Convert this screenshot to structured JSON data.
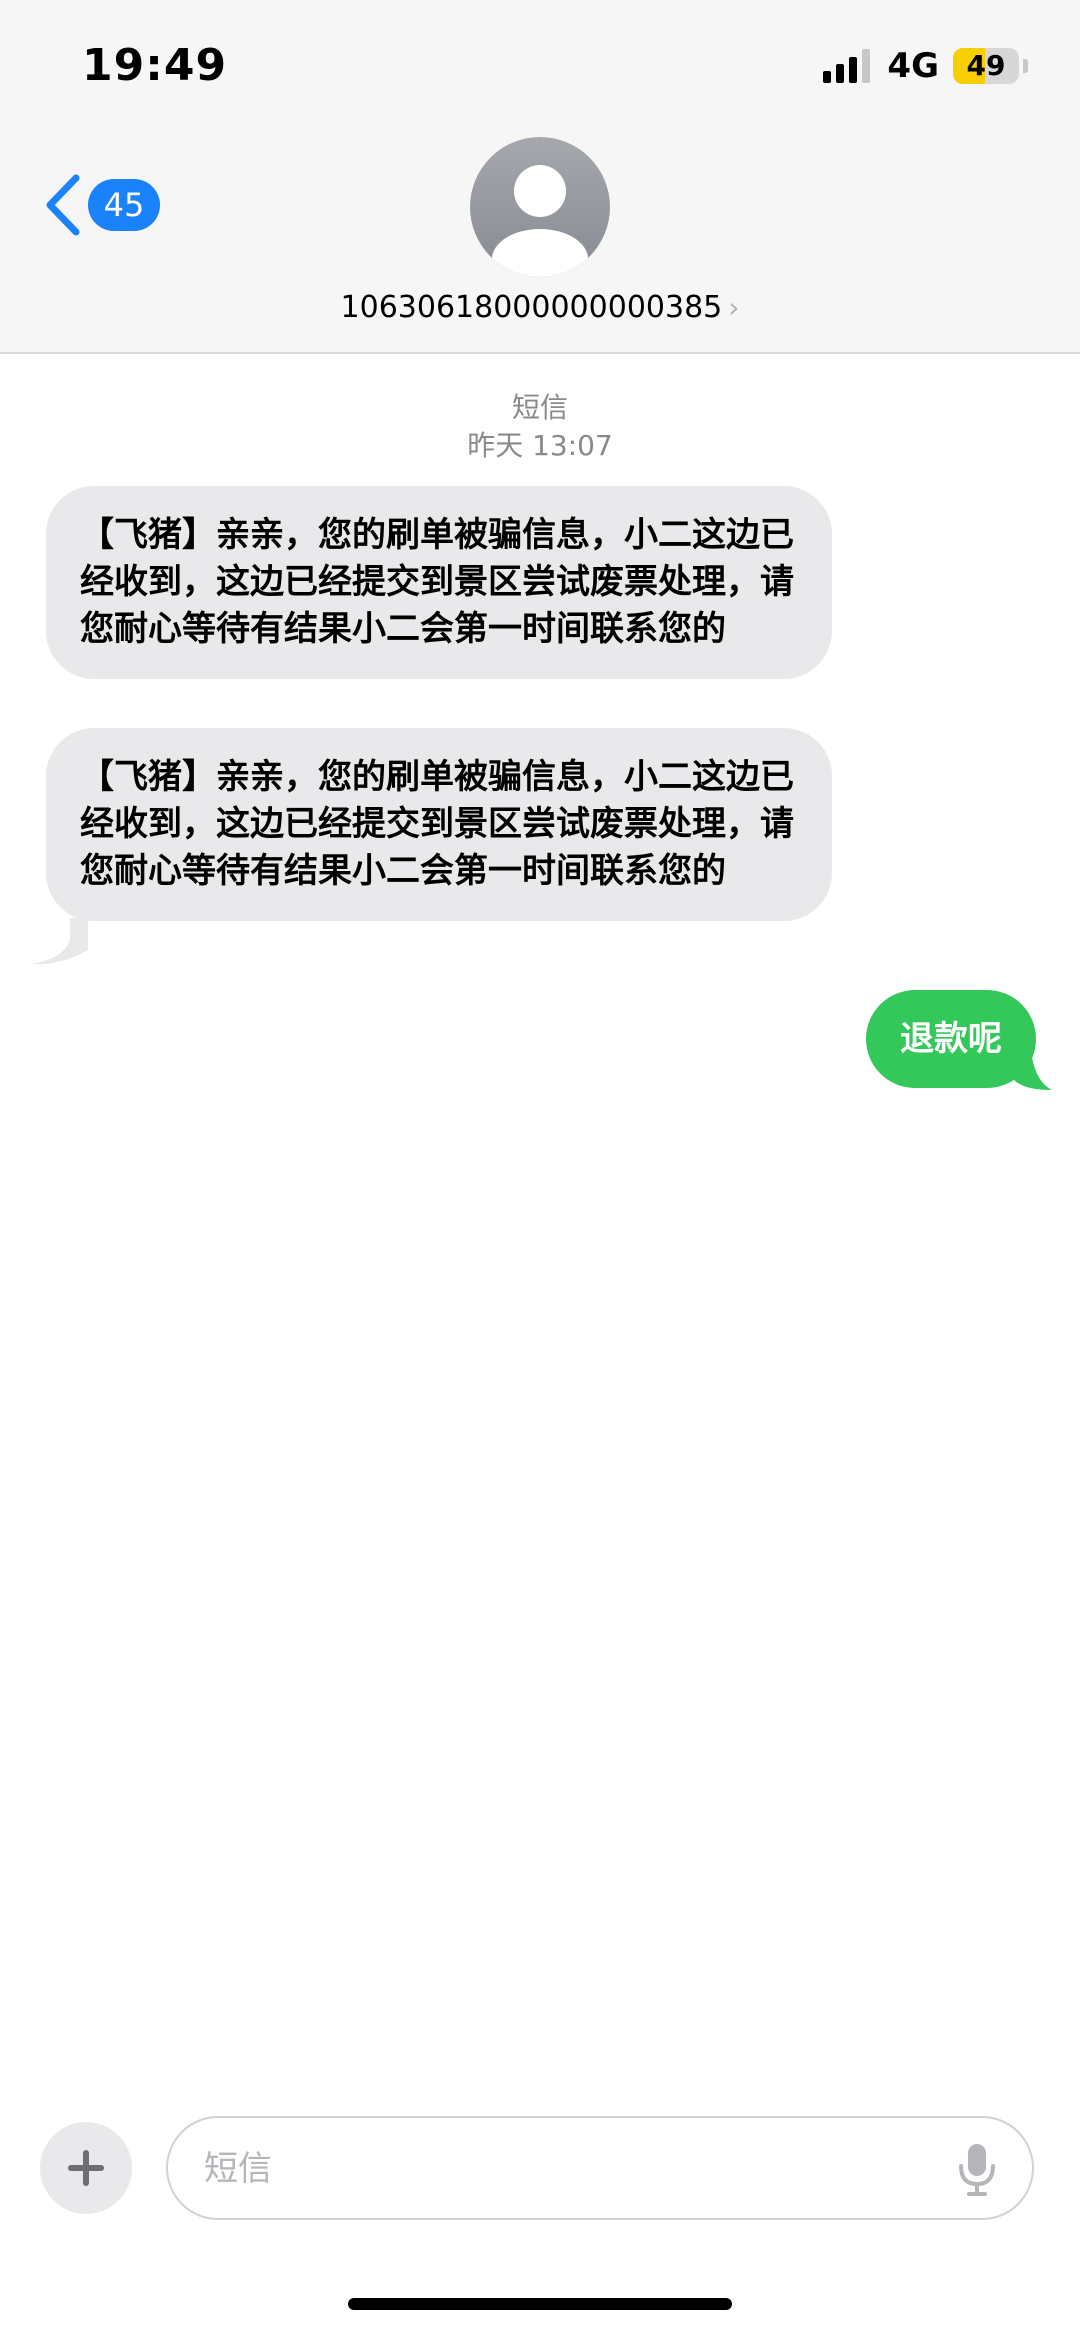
{
  "status_bar": {
    "time": "19:49",
    "network": "4G",
    "battery_level": "49",
    "battery_fraction": 0.49
  },
  "header": {
    "back_count": "45",
    "contact_name": "10630618000000000385",
    "chevron": "›"
  },
  "conversation": {
    "service_label": "短信",
    "timestamp": "昨天 13:07",
    "messages": [
      {
        "direction": "incoming",
        "text": "【飞猪】亲亲，您的刷单被骗信息，小二这边已经收到，这边已经提交到景区尝试废票处理，请您耐心等待有结果小二会第一时间联系您的"
      },
      {
        "direction": "incoming",
        "text": "【飞猪】亲亲，您的刷单被骗信息，小二这边已经收到，这边已经提交到景区尝试废票处理，请您耐心等待有结果小二会第一时间联系您的"
      },
      {
        "direction": "outgoing",
        "text": "退款呢"
      }
    ]
  },
  "composer": {
    "placeholder": "短信"
  },
  "colors": {
    "accent_blue": "#1a82fb",
    "outgoing_green": "#34c759",
    "incoming_gray": "#e9e9eb",
    "battery_yellow": "#f7ce00"
  }
}
